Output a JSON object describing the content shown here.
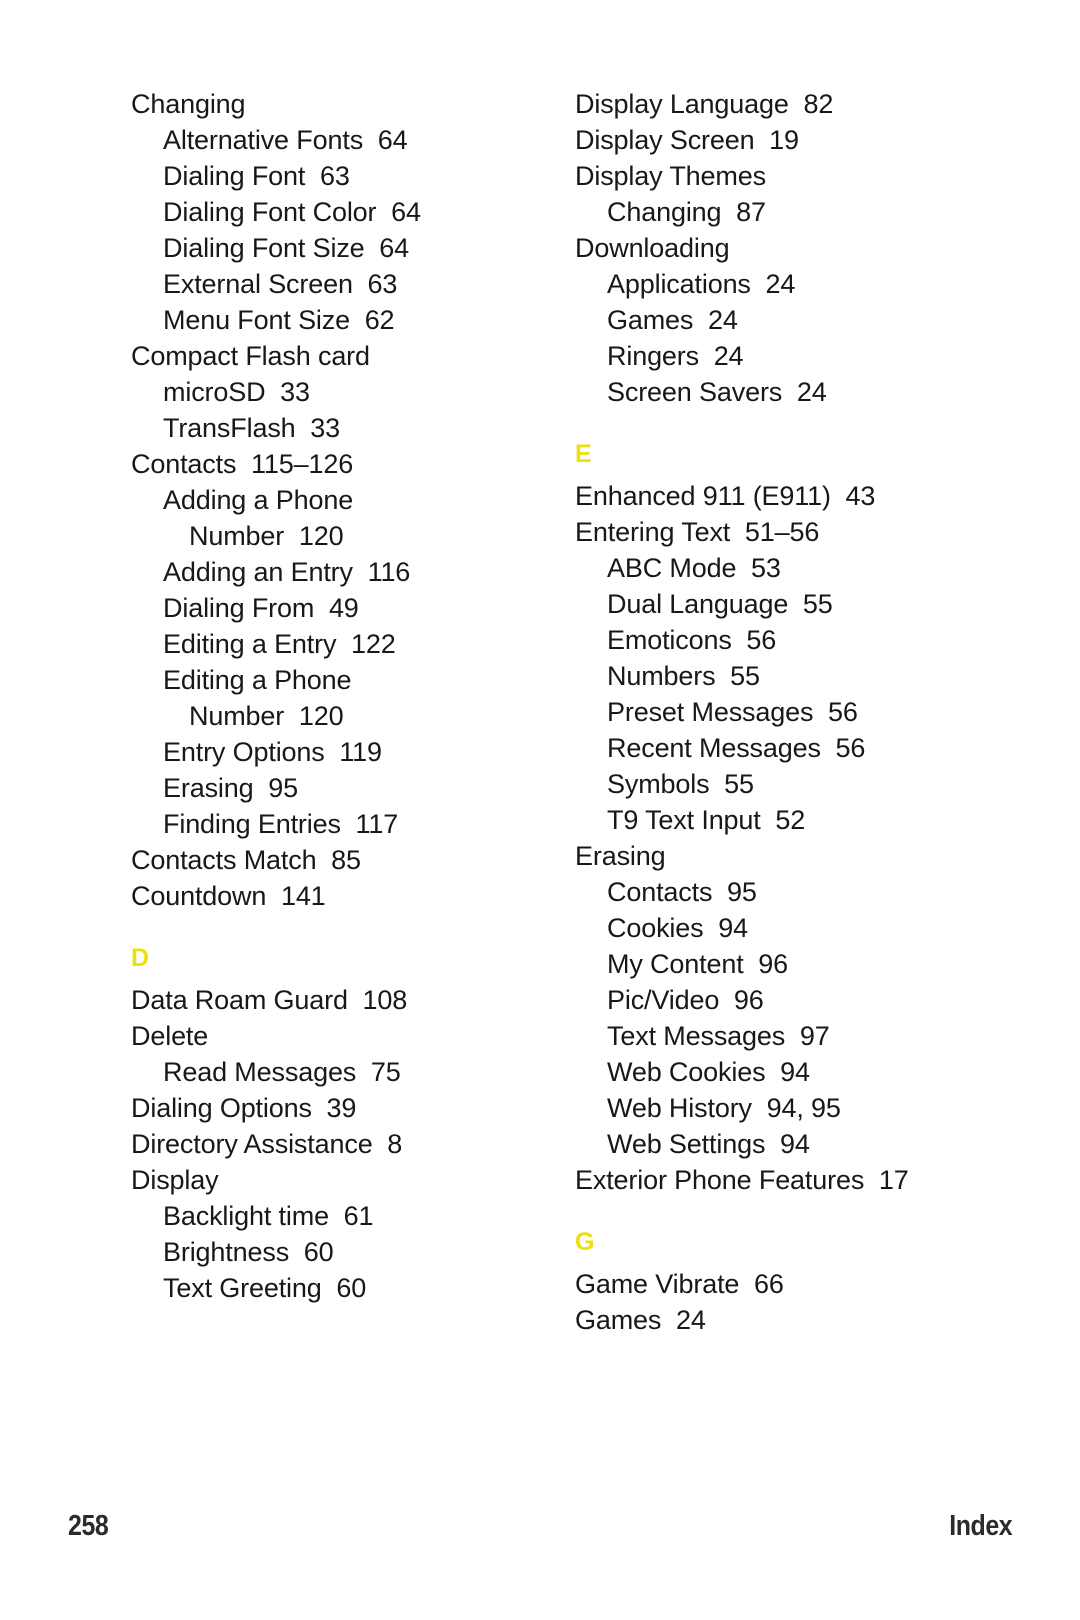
{
  "page": {
    "page_number": "258",
    "footer_label": "Index",
    "accent_color": "#ECE00F",
    "text_color": "#181818"
  },
  "columns": [
    {
      "name": "left-column",
      "blocks": [
        {
          "type": "entries",
          "entries": [
            {
              "level": 1,
              "text": "Changing"
            },
            {
              "level": 2,
              "text": "Alternative Fonts  64"
            },
            {
              "level": 2,
              "text": "Dialing Font  63"
            },
            {
              "level": 2,
              "text": "Dialing Font Color  64"
            },
            {
              "level": 2,
              "text": "Dialing Font Size  64"
            },
            {
              "level": 2,
              "text": "External Screen  63"
            },
            {
              "level": 2,
              "text": "Menu Font Size  62"
            },
            {
              "level": 1,
              "text": "Compact Flash card"
            },
            {
              "level": 2,
              "text": "microSD  33"
            },
            {
              "level": 2,
              "text": "TransFlash  33"
            },
            {
              "level": 1,
              "text": "Contacts  115–126"
            },
            {
              "level": 2,
              "text": "Adding a Phone Number  120"
            },
            {
              "level": 2,
              "text": "Adding an Entry  116"
            },
            {
              "level": 2,
              "text": "Dialing From  49"
            },
            {
              "level": 2,
              "text": "Editing a Entry  122"
            },
            {
              "level": 2,
              "text": "Editing a Phone Number  120"
            },
            {
              "level": 2,
              "text": "Entry Options  119"
            },
            {
              "level": 2,
              "text": "Erasing  95"
            },
            {
              "level": 2,
              "text": "Finding Entries  117"
            },
            {
              "level": 1,
              "text": "Contacts Match  85"
            },
            {
              "level": 1,
              "text": "Countdown  141"
            }
          ]
        },
        {
          "type": "letter",
          "letter": "D"
        },
        {
          "type": "entries",
          "entries": [
            {
              "level": 1,
              "text": "Data Roam Guard  108"
            },
            {
              "level": 1,
              "text": "Delete"
            },
            {
              "level": 2,
              "text": "Read Messages  75"
            },
            {
              "level": 1,
              "text": "Dialing Options  39"
            },
            {
              "level": 1,
              "text": "Directory Assistance  8"
            },
            {
              "level": 1,
              "text": "Display"
            },
            {
              "level": 2,
              "text": "Backlight time  61"
            },
            {
              "level": 2,
              "text": "Brightness  60"
            },
            {
              "level": 2,
              "text": "Text Greeting  60"
            }
          ]
        }
      ]
    },
    {
      "name": "right-column",
      "blocks": [
        {
          "type": "entries",
          "entries": [
            {
              "level": 1,
              "text": "Display Language  82"
            },
            {
              "level": 1,
              "text": "Display Screen  19"
            },
            {
              "level": 1,
              "text": "Display Themes"
            },
            {
              "level": 2,
              "text": "Changing  87"
            },
            {
              "level": 1,
              "text": "Downloading"
            },
            {
              "level": 2,
              "text": "Applications  24"
            },
            {
              "level": 2,
              "text": "Games  24"
            },
            {
              "level": 2,
              "text": "Ringers  24"
            },
            {
              "level": 2,
              "text": "Screen Savers  24"
            }
          ]
        },
        {
          "type": "letter",
          "letter": "E"
        },
        {
          "type": "entries",
          "entries": [
            {
              "level": 1,
              "text": "Enhanced 911 (E911)  43"
            },
            {
              "level": 1,
              "text": "Entering Text  51–56"
            },
            {
              "level": 2,
              "text": "ABC Mode  53"
            },
            {
              "level": 2,
              "text": "Dual Language  55"
            },
            {
              "level": 2,
              "text": "Emoticons  56"
            },
            {
              "level": 2,
              "text": "Numbers  55"
            },
            {
              "level": 2,
              "text": "Preset Messages  56"
            },
            {
              "level": 2,
              "text": "Recent Messages  56"
            },
            {
              "level": 2,
              "text": "Symbols  55"
            },
            {
              "level": 2,
              "text": "T9 Text Input  52"
            },
            {
              "level": 1,
              "text": "Erasing"
            },
            {
              "level": 2,
              "text": "Contacts  95"
            },
            {
              "level": 2,
              "text": "Cookies  94"
            },
            {
              "level": 2,
              "text": "My Content  96"
            },
            {
              "level": 2,
              "text": "Pic/Video  96"
            },
            {
              "level": 2,
              "text": "Text Messages  97"
            },
            {
              "level": 2,
              "text": "Web Cookies  94"
            },
            {
              "level": 2,
              "text": "Web History  94, 95"
            },
            {
              "level": 2,
              "text": "Web Settings  94"
            },
            {
              "level": 1,
              "text": "Exterior Phone Features  17"
            }
          ]
        },
        {
          "type": "letter",
          "letter": "G"
        },
        {
          "type": "entries",
          "entries": [
            {
              "level": 1,
              "text": "Game Vibrate  66"
            },
            {
              "level": 1,
              "text": "Games  24"
            }
          ]
        }
      ]
    }
  ]
}
